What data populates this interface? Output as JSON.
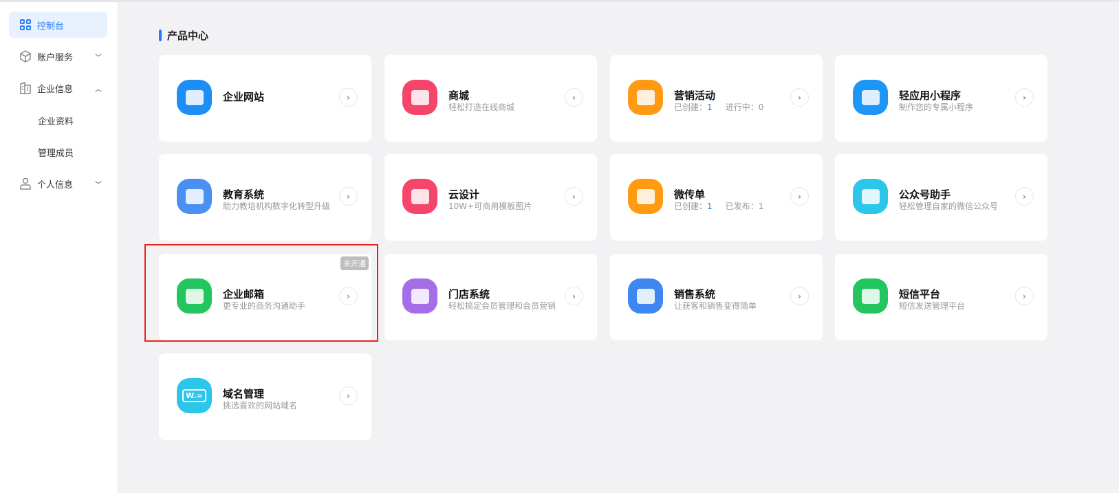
{
  "sidebar": {
    "items": [
      {
        "label": "控制台",
        "icon": "dashboard-icon",
        "active": true
      },
      {
        "label": "账户服务",
        "icon": "box-icon",
        "expand": "﹀"
      },
      {
        "label": "企业信息",
        "icon": "building-icon",
        "expand": "︿"
      },
      {
        "label": "企业资料"
      },
      {
        "label": "管理成员"
      },
      {
        "label": "个人信息",
        "icon": "user-icon",
        "expand": "﹀"
      }
    ]
  },
  "section_title": "产品中心",
  "arrow": "›",
  "cards": [
    {
      "name": "企业网站",
      "desc": "",
      "color": "#1e8ef7"
    },
    {
      "name": "商城",
      "desc": "轻松打造在线商城",
      "color": "#f5456a"
    },
    {
      "name": "营销活动",
      "s1": "已创建：",
      "v1": "1",
      "s2": "进行中：",
      "v2": "0",
      "color": "#ff9a12"
    },
    {
      "name": "轻应用小程序",
      "desc": "制作您的专属小程序",
      "color": "#1e96f7"
    },
    {
      "name": "教育系统",
      "desc": "助力教培机构数字化转型升级",
      "color": "#4a8ff2"
    },
    {
      "name": "云设计",
      "desc": "10W+可商用模板图片",
      "color": "#f5456a"
    },
    {
      "name": "微传单",
      "s1": "已创建：",
      "v1": "1",
      "s2": "已发布：",
      "v2": "1",
      "color": "#ff9a12"
    },
    {
      "name": "公众号助手",
      "desc": "轻松管理自家的微信公众号",
      "color": "#2cc6ea"
    },
    {
      "name": "企业邮箱",
      "desc": "更专业的商务沟通助手",
      "badge": "未开通",
      "color": "#22c55e"
    },
    {
      "name": "门店系统",
      "desc": "轻松搞定会员管理和会员营销",
      "color": "#a46ee8"
    },
    {
      "name": "销售系统",
      "desc": "让获客和销售变得简单",
      "color": "#3e86f0"
    },
    {
      "name": "短信平台",
      "desc": "短信发送管理平台",
      "color": "#22c55e"
    },
    {
      "name": "域名管理",
      "desc": "挑选喜欢的网站域名",
      "icon_text": "W.=",
      "color": "#2cc6ea"
    }
  ]
}
